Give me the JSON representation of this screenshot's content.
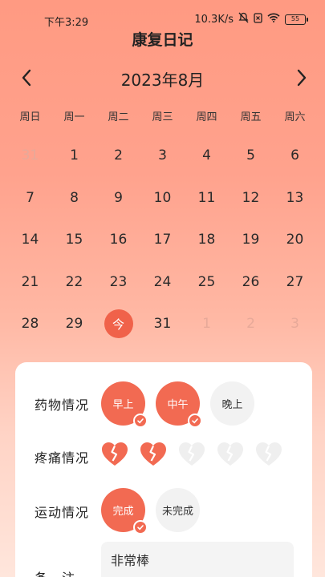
{
  "status_bar": {
    "time": "下午3:29",
    "network_speed": "10.3K/s",
    "battery": "55"
  },
  "header": {
    "title": "康复日记"
  },
  "calendar": {
    "month_label": "2023年8月",
    "weekdays": [
      "周日",
      "周一",
      "周二",
      "周三",
      "周四",
      "周五",
      "周六"
    ],
    "days": [
      {
        "label": "31",
        "muted": true
      },
      {
        "label": "1"
      },
      {
        "label": "2"
      },
      {
        "label": "3"
      },
      {
        "label": "4"
      },
      {
        "label": "5"
      },
      {
        "label": "6"
      },
      {
        "label": "7"
      },
      {
        "label": "8"
      },
      {
        "label": "9"
      },
      {
        "label": "10"
      },
      {
        "label": "11"
      },
      {
        "label": "12"
      },
      {
        "label": "13"
      },
      {
        "label": "14"
      },
      {
        "label": "15"
      },
      {
        "label": "16"
      },
      {
        "label": "17"
      },
      {
        "label": "18"
      },
      {
        "label": "19"
      },
      {
        "label": "20"
      },
      {
        "label": "21"
      },
      {
        "label": "22"
      },
      {
        "label": "23"
      },
      {
        "label": "24"
      },
      {
        "label": "25"
      },
      {
        "label": "26"
      },
      {
        "label": "27"
      },
      {
        "label": "28"
      },
      {
        "label": "29"
      },
      {
        "label": "今",
        "today": true
      },
      {
        "label": "31"
      },
      {
        "label": "1",
        "muted": true
      },
      {
        "label": "2",
        "muted": true
      },
      {
        "label": "3",
        "muted": true
      }
    ]
  },
  "record": {
    "medication": {
      "label": "药物情况",
      "options": [
        {
          "label": "早上",
          "checked": true
        },
        {
          "label": "中午",
          "checked": true
        },
        {
          "label": "晚上",
          "checked": false
        }
      ]
    },
    "pain": {
      "label": "疼痛情况",
      "level": 2,
      "max": 5
    },
    "exercise": {
      "label": "运动情况",
      "options": [
        {
          "label": "完成",
          "checked": true
        },
        {
          "label": "未完成",
          "checked": false
        }
      ]
    },
    "note": {
      "label": "备　注",
      "value": "非常棒"
    }
  },
  "colors": {
    "accent": "#f26a52",
    "inactive": "#f2f2f2"
  }
}
